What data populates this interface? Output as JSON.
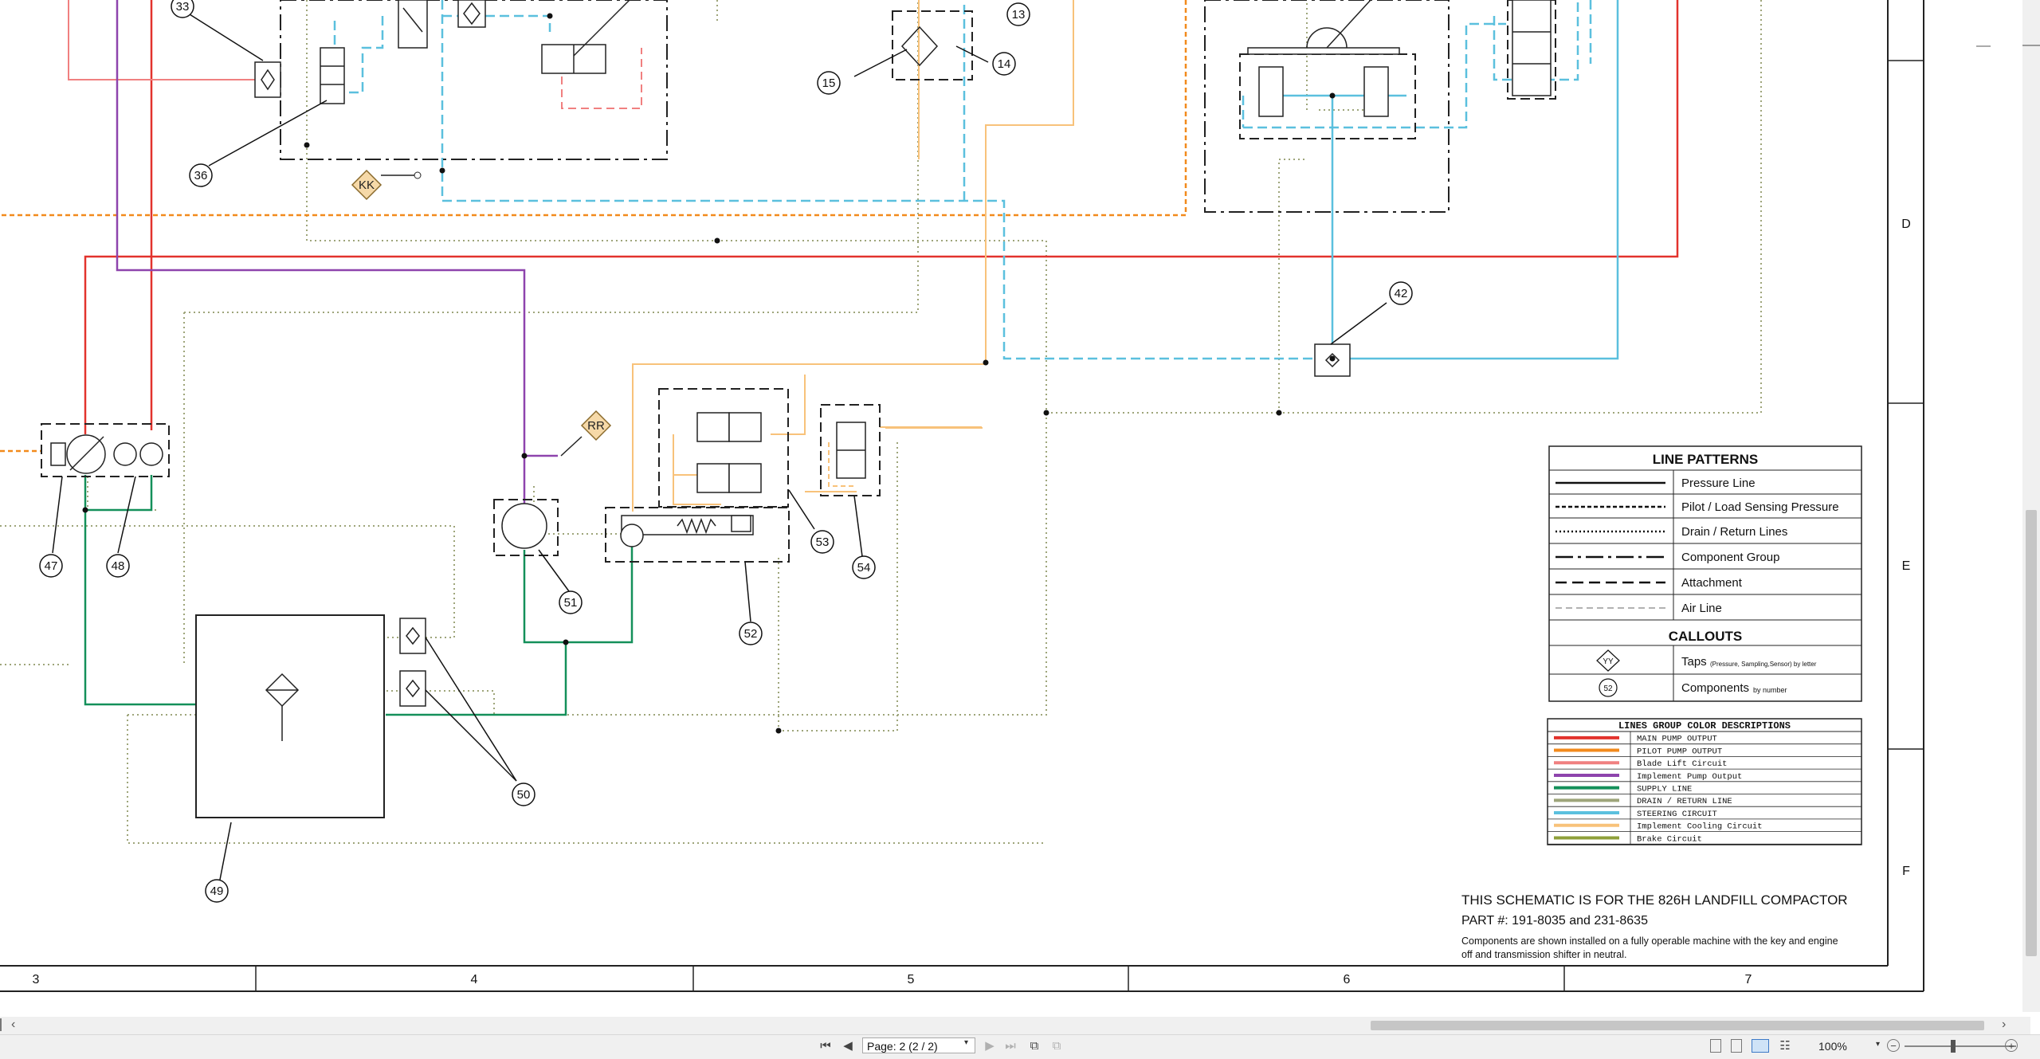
{
  "schematic": {
    "grid": {
      "columns": [
        "3",
        "4",
        "5",
        "6",
        "7"
      ],
      "rows": [
        "D",
        "E",
        "F"
      ]
    },
    "callouts": [
      "33",
      "36",
      "13",
      "14",
      "15",
      "42",
      "47",
      "48",
      "51",
      "53",
      "54",
      "52",
      "50",
      "49"
    ],
    "taps": [
      "KK",
      "RR"
    ],
    "line_patterns": {
      "title": "LINE PATTERNS",
      "items": [
        "Pressure Line",
        "Pilot / Load Sensing Pressure",
        "Drain / Return Lines",
        "Component Group",
        "Attachment",
        "Air Line"
      ]
    },
    "callouts_legend": {
      "title": "CALLOUTS",
      "taps_symbol": "YY",
      "taps_label": "Taps",
      "taps_note": "(Pressure, Sampling,Sensor) by letter",
      "components_symbol": "52",
      "components_label": "Components",
      "components_note": "by number"
    },
    "color_legend": {
      "title": "LINES GROUP COLOR DESCRIPTIONS",
      "items": [
        {
          "label": "MAIN PUMP OUTPUT",
          "color": "#e2332d"
        },
        {
          "label": "PILOT PUMP OUTPUT",
          "color": "#f28a1c"
        },
        {
          "label": "Blade Lift Circuit",
          "color": "#f08080"
        },
        {
          "label": "Implement Pump Output",
          "color": "#8e44ad"
        },
        {
          "label": "SUPPLY LINE",
          "color": "#14905a"
        },
        {
          "label": "DRAIN / RETURN LINE",
          "color": "#9ea57a"
        },
        {
          "label": "STEERING CIRCUIT",
          "color": "#5bc0de"
        },
        {
          "label": "Implement Cooling Circuit",
          "color": "#f8c27a"
        },
        {
          "label": "Brake Circuit",
          "color": "#8fa03a"
        }
      ]
    },
    "note": {
      "title": "THIS SCHEMATIC IS FOR THE 826H LANDFILL COMPACTOR",
      "part": "PART #: 191-8035 and 231-8635",
      "line1": "Components are shown installed on a fully operable machine with the key and engine",
      "line2": "off and transmission shifter in neutral."
    }
  },
  "statusbar": {
    "page_field": "Page: 2 (2 / 2)",
    "zoom": "100%"
  }
}
